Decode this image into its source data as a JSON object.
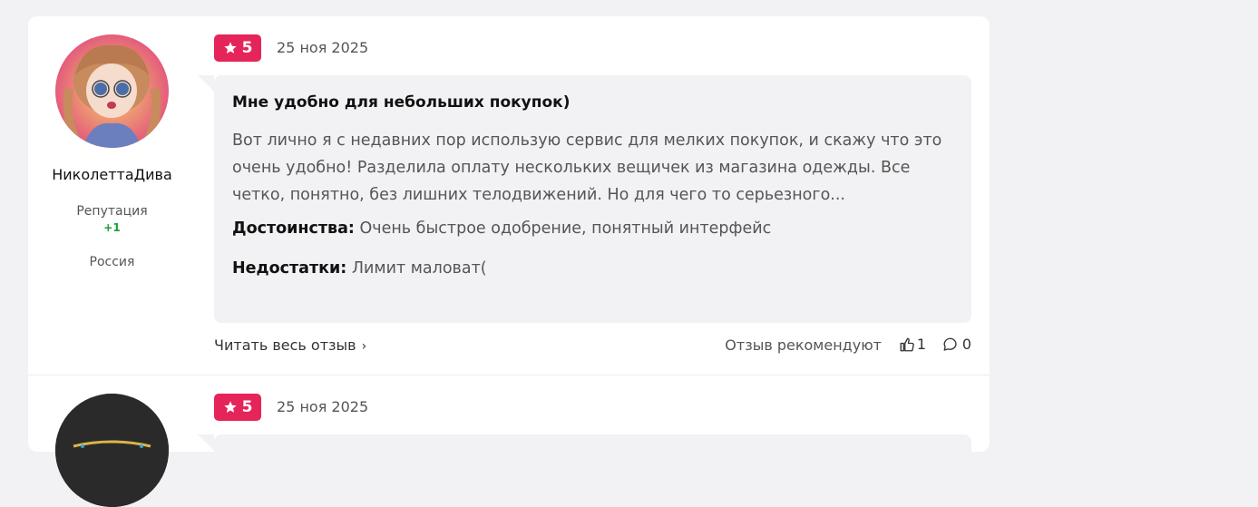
{
  "colors": {
    "accent": "#e5245a",
    "reputation": "#1a9e3a"
  },
  "reviews": [
    {
      "author": {
        "name": "НиколеттаДива",
        "reputation_label": "Репутация",
        "reputation_value": "+1",
        "country": "Россия"
      },
      "rating": "5",
      "date": "25 ноя 2025",
      "title": "Мне удобно для небольших покупок)",
      "text": "Вот лично я с недавних пор использую сервис для мелких покупок, и скажу что это очень удобно! Разделила оплату нескольких вещичек из магазина одежды. Все четко, понятно, без лишних телодвижений. Но для чего то серьезного...",
      "pros_label": "Достоинства:",
      "pros": "Очень быстрое одобрение, понятный интерфейс",
      "cons_label": "Недостатки:",
      "cons": "Лимит маловат(",
      "read_more": "Читать весь отзыв",
      "recommend": "Отзыв рекомендуют",
      "likes": "1",
      "comments": "0"
    },
    {
      "rating": "5",
      "date": "25 ноя 2025"
    }
  ]
}
